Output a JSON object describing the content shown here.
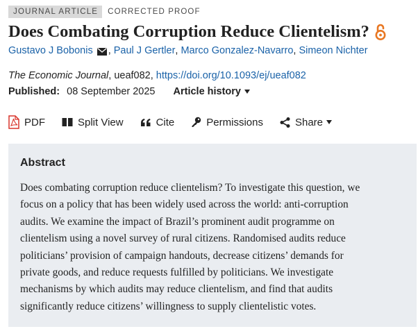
{
  "tags": {
    "type": "JOURNAL ARTICLE",
    "status": "CORRECTED PROOF"
  },
  "title": "Does Combating Corruption Reduce Clientelism?",
  "authors": [
    {
      "name": "Gustavo J Bobonis"
    },
    {
      "name": "Paul J Gertler"
    },
    {
      "name": "Marco Gonzalez-Navarro"
    },
    {
      "name": "Simeon Nichter"
    }
  ],
  "citation": {
    "journal": "The Economic Journal",
    "article_id": ", ueaf082, ",
    "doi": "https://doi.org/10.1093/ej/ueaf082"
  },
  "published": {
    "label": "Published:",
    "date": "08 September 2025",
    "history_label": "Article history"
  },
  "toolbar": {
    "pdf": "PDF",
    "split_view": "Split View",
    "cite": "Cite",
    "permissions": "Permissions",
    "share": "Share"
  },
  "abstract": {
    "heading": "Abstract",
    "lines": [
      "Does combating corruption reduce clientelism? To investigate this question, we",
      "focus on a policy that has been widely used across the world: anti-corruption",
      "audits. We examine the impact of Brazil’s prominent audit programme on",
      "clientelism using a novel survey of rural citizens. Randomised audits reduce",
      "politicians’ provision of campaign handouts, decrease citizens’ demands for",
      "private goods, and reduce requests fulfilled by politicians. We investigate",
      "mechanisms by which audits may reduce clientelism, and find that audits",
      "significantly reduce citizens’ willingness to supply clientelistic votes."
    ]
  },
  "colors": {
    "link": "#1a62a8",
    "accent": "#e87722",
    "abstract_bg": "#eaedf1",
    "pdf_red": "#d9342b"
  }
}
